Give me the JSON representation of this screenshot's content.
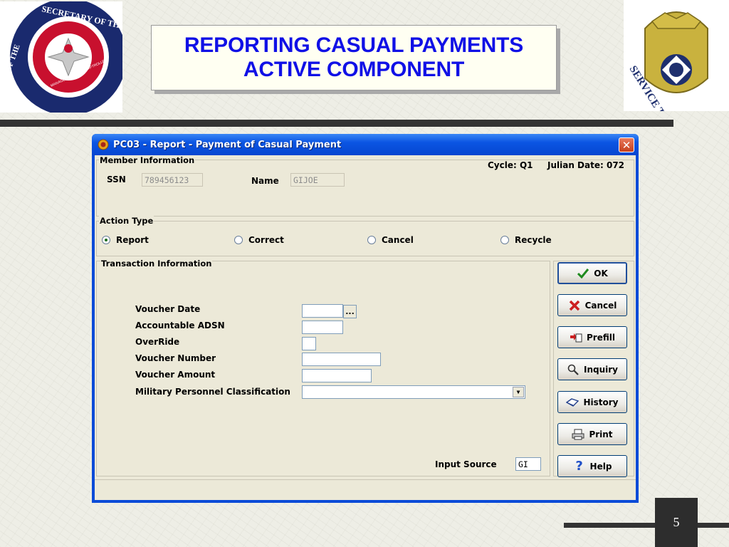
{
  "slide": {
    "title_line1": "REPORTING CASUAL PAYMENTS",
    "title_line2": "ACTIVE COMPONENT",
    "page_number": "5",
    "logo_left_text": "SECRETARY OF THE ARMY",
    "logo_left_subtext": "MANAGEMENT AND COMPTROLLER",
    "logo_left_prefix": "OF THE",
    "logo_right_text": "SERVICE TO SOLDIERS"
  },
  "window": {
    "title": "PC03 - Report - Payment of Casual Payment",
    "close_label": "✕"
  },
  "member_info": {
    "group_label": "Member Information",
    "cycle_label": "Cycle: Q1",
    "julian_label": "Julian Date: 072",
    "ssn_label": "SSN",
    "ssn_value": "789456123",
    "name_label": "Name",
    "name_value": "GIJOE"
  },
  "action_type": {
    "group_label": "Action Type",
    "options": [
      {
        "label": "Report",
        "selected": true
      },
      {
        "label": "Correct",
        "selected": false
      },
      {
        "label": "Cancel",
        "selected": false
      },
      {
        "label": "Recycle",
        "selected": false
      }
    ]
  },
  "transaction": {
    "group_label": "Transaction Information",
    "voucher_date_label": "Voucher Date",
    "voucher_date_value": "",
    "ellipsis_label": "...",
    "accountable_adsn_label": "Accountable ADSN",
    "accountable_adsn_value": "",
    "override_label": "OverRide",
    "override_value": "",
    "voucher_number_label": "Voucher Number",
    "voucher_number_value": "",
    "voucher_amount_label": "Voucher Amount",
    "voucher_amount_value": "",
    "mpc_label": "Military Personnel Classification",
    "mpc_value": "",
    "input_source_label": "Input Source",
    "input_source_value": "GI"
  },
  "buttons": {
    "ok": "OK",
    "cancel": "Cancel",
    "prefill": "Prefill",
    "inquiry": "Inquiry",
    "history": "History",
    "print": "Print",
    "help": "Help"
  },
  "colors": {
    "title_blue": "#1010e6",
    "xp_titlebar": "#0b55e3",
    "window_bg": "#ece9d8"
  }
}
